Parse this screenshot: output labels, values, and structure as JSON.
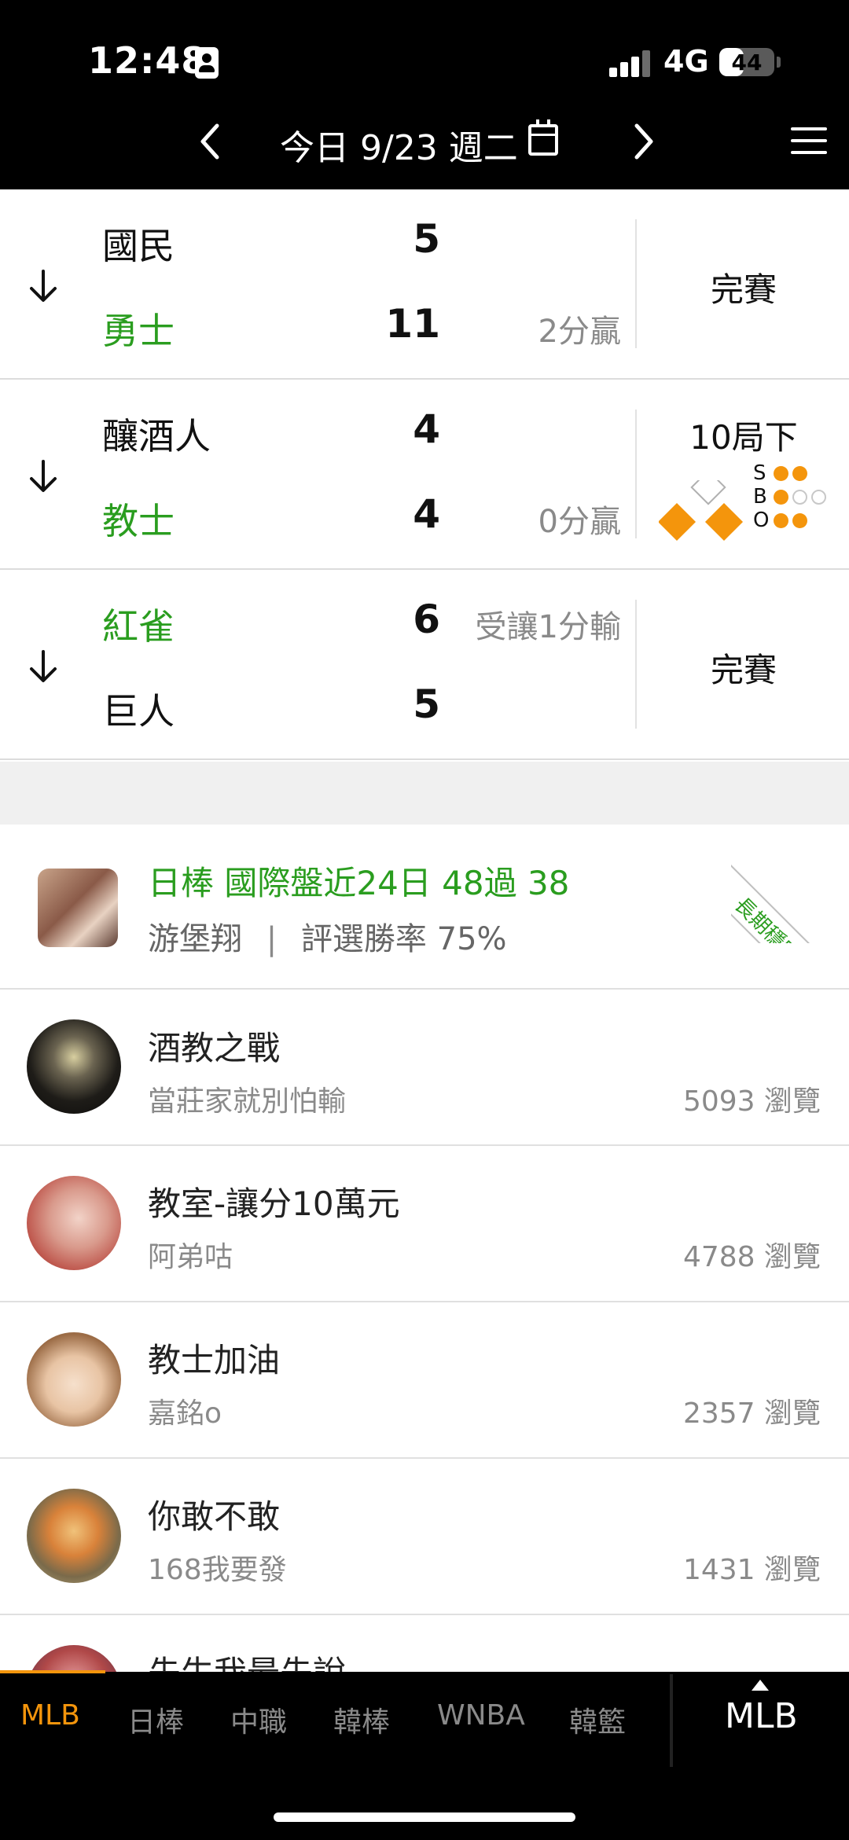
{
  "status_bar": {
    "time": "12:48",
    "network": "4G",
    "battery": "44",
    "battery_level": 0.44
  },
  "header": {
    "date_title": "今日 9/23 週二"
  },
  "games": [
    {
      "away": "國民",
      "away_score": "5",
      "away_note": "",
      "home": "勇士",
      "home_score": "11",
      "home_note": "2分贏",
      "status": "完賽",
      "winner_side": "home"
    },
    {
      "away": "釀酒人",
      "away_score": "4",
      "away_note": "",
      "home": "教士",
      "home_score": "4",
      "home_note": "0分贏",
      "status": "10局下",
      "winner_side": "home",
      "live": {
        "sbo_letters": [
          "S",
          "B",
          "O"
        ],
        "strikes": 2,
        "balls": 1,
        "outs": 2,
        "bases": {
          "first": true,
          "second": false,
          "third": true
        }
      }
    },
    {
      "away": "紅雀",
      "away_score": "6",
      "away_note": "受讓1分輸",
      "home": "巨人",
      "home_score": "5",
      "home_note": "",
      "status": "完賽",
      "winner_side": "away"
    }
  ],
  "featured": {
    "title": "日棒 國際盤近24日 48過 38",
    "author": "游堡翔",
    "separator": "|",
    "win_rate": "評選勝率 75%",
    "badge": "長期穩定"
  },
  "posts": [
    {
      "title": "酒教之戰",
      "author": "當莊家就別怕輸",
      "views": "5093 瀏覽"
    },
    {
      "title": "教室-讓分10萬元",
      "author": "阿弟咕",
      "views": "4788 瀏覽"
    },
    {
      "title": "教士加油",
      "author": "嘉銘o",
      "views": "2357 瀏覽"
    },
    {
      "title": "你敢不敢",
      "author": "168我要發",
      "views": "1431 瀏覽"
    },
    {
      "title": "先生我最先說",
      "author": "",
      "views": ""
    }
  ],
  "tabs": [
    "MLB",
    "日棒",
    "中職",
    "韓棒",
    "WNBA",
    "韓籃"
  ],
  "active_tab": "MLB",
  "current_league": "MLB",
  "colors": {
    "accent": "#f4950c",
    "winner": "#2a9d1f",
    "header_bg": "#000000"
  }
}
